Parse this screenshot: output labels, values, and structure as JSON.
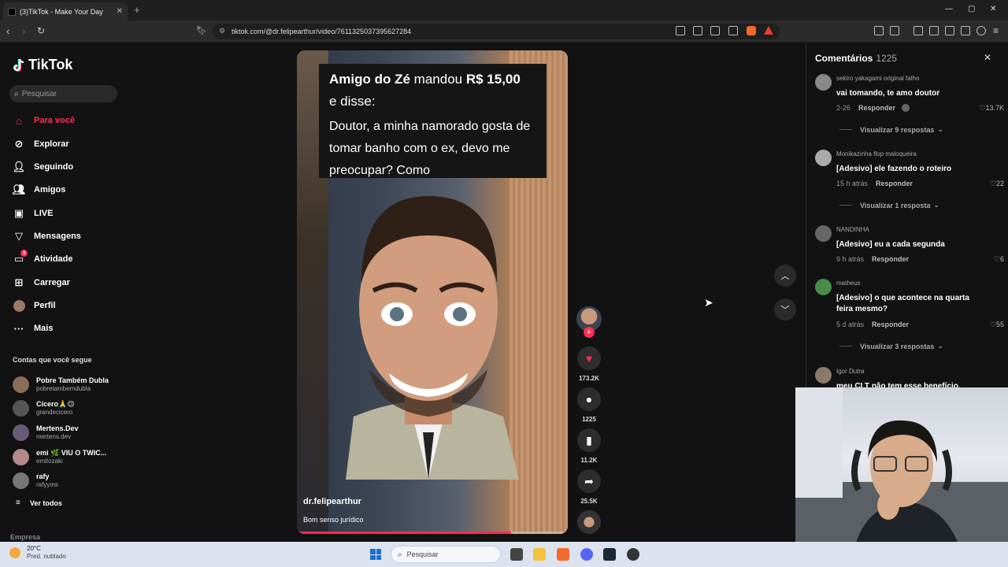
{
  "browser": {
    "tab_title": "(3)TikTok - Make Your Day",
    "tab_close": "✕",
    "new_tab": "+",
    "url": "tiktok.com/@dr.felipearthur/video/7611325037395627284",
    "win_min": "—",
    "win_max": "▢",
    "win_close": "✕"
  },
  "sidebar": {
    "logo": "TikTok",
    "search_placeholder": "Pesquisar",
    "nav": [
      {
        "label": "Para você",
        "icon": "home-icon"
      },
      {
        "label": "Explorar",
        "icon": "compass-icon"
      },
      {
        "label": "Seguindo",
        "icon": "following-icon"
      },
      {
        "label": "Amigos",
        "icon": "friends-icon"
      },
      {
        "label": "LIVE",
        "icon": "live-icon"
      },
      {
        "label": "Mensagens",
        "icon": "messages-icon"
      },
      {
        "label": "Atividade",
        "icon": "activity-icon",
        "badge": "3"
      },
      {
        "label": "Carregar",
        "icon": "upload-icon"
      },
      {
        "label": "Perfil",
        "icon": "profile-icon"
      },
      {
        "label": "Mais",
        "icon": "more-icon"
      }
    ],
    "following_header": "Contas que você segue",
    "following": [
      {
        "name": "Pobre Também Dubla",
        "handle": "pobretambemdubla",
        "color": "#8a6d5a"
      },
      {
        "name": "Cícero🙏😉",
        "handle": "grandecicero",
        "color": "#555555"
      },
      {
        "name": "Mertens.Dev",
        "handle": "mertens.dev",
        "color": "#6a5a7a"
      },
      {
        "name": "emi 🌿 VIU O TWIC...",
        "handle": "emitozaki",
        "color": "#b58a8a"
      },
      {
        "name": "rafy",
        "handle": "rafyyms",
        "color": "#777777"
      }
    ],
    "see_all": "Ver todos",
    "company": "Empresa"
  },
  "video": {
    "caption_line1_a": "Amigo do Zé",
    "caption_line1_b": " mandou ",
    "caption_line1_c": "R$ 15,00",
    "caption_line2": "e disse:",
    "caption_body": "Doutor, a minha namorado gosta de tomar banho com o ex, devo me preocupar? Como",
    "username": "dr.felipearthur",
    "description": "Bom senso jurídico",
    "progress": 0.79
  },
  "actions": {
    "likes": "173.2K",
    "comments": "1225",
    "saves": "11.2K",
    "shares": "25.5K"
  },
  "comments_panel": {
    "title": "Comentários",
    "count": "1225",
    "items": [
      {
        "user": "sekiro yakagami original falho",
        "text": "vai tomando, te amo doutor",
        "date": "2-26",
        "reply": "Responder",
        "likes": "13.7K",
        "more": "Visualizar 9 respostas",
        "color": "#888"
      },
      {
        "user": "Monikazinha flop maloqueira",
        "text": "[Adesivo] ele fazendo o roteiro",
        "date": "15 h atrás",
        "reply": "Responder",
        "likes": "22",
        "more": "Visualizar 1 resposta",
        "color": "#aaa"
      },
      {
        "user": "NANDINHA",
        "text": "[Adesivo] eu a cada segunda",
        "date": "9 h atrás",
        "reply": "Responder",
        "likes": "6",
        "more": "",
        "color": "#666"
      },
      {
        "user": "matheus",
        "text": "[Adesivo] o que acontece na quarta feira mesmo?",
        "date": "5 d atrás",
        "reply": "Responder",
        "likes": "55",
        "more": "Visualizar 3 respostas",
        "color": "#4a8a4a"
      },
      {
        "user": "Igor Dutra",
        "text": "meu CLT não tem esse benefício. Posso",
        "date": "",
        "reply": "",
        "likes": "",
        "more": "",
        "color": "#8a7a6a"
      }
    ]
  },
  "taskbar": {
    "temp": "20°C",
    "weather": "Pred. nublado",
    "search": "Pesquisar"
  }
}
